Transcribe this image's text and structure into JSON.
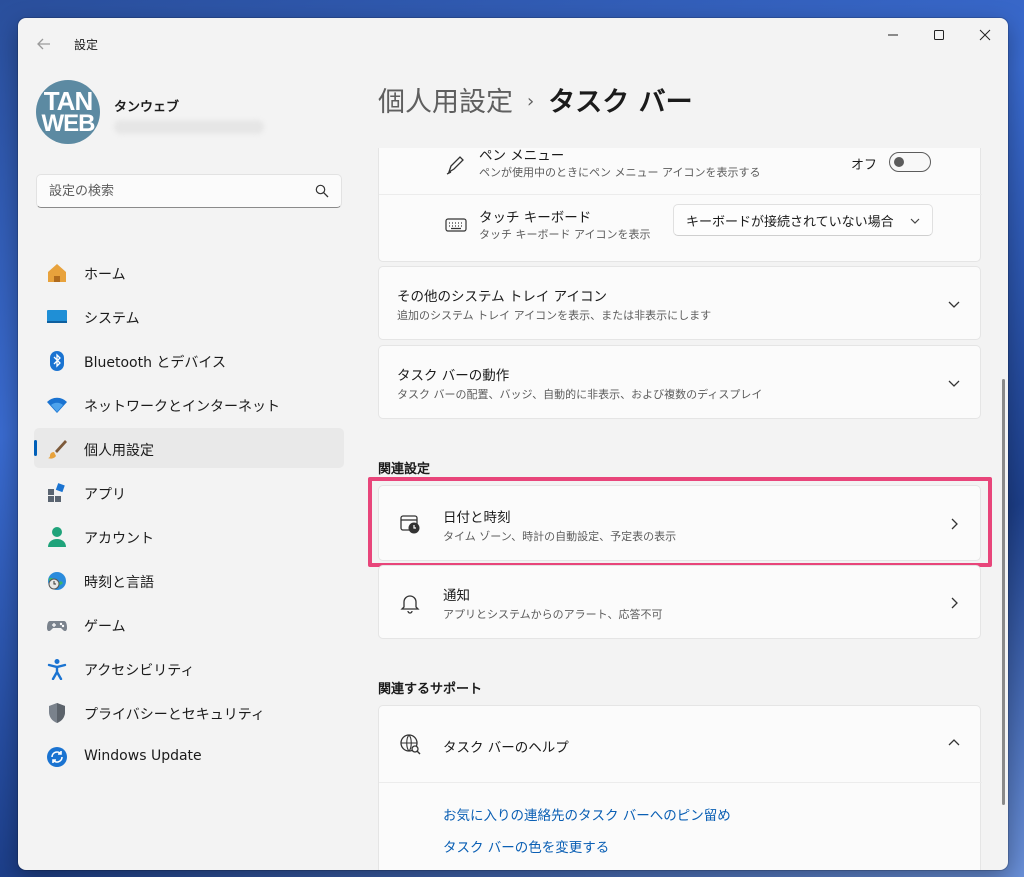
{
  "window": {
    "app_title": "設定"
  },
  "profile": {
    "name": "タンウェブ",
    "avatar_text_1": "TAN",
    "avatar_text_2": "WEB"
  },
  "search": {
    "placeholder": "設定の検索"
  },
  "sidebar": {
    "items": [
      {
        "label": "ホーム",
        "icon": "home-icon"
      },
      {
        "label": "システム",
        "icon": "display-icon"
      },
      {
        "label": "Bluetooth とデバイス",
        "icon": "bluetooth-icon"
      },
      {
        "label": "ネットワークとインターネット",
        "icon": "wifi-icon"
      },
      {
        "label": "個人用設定",
        "icon": "brush-icon",
        "active": true
      },
      {
        "label": "アプリ",
        "icon": "apps-icon"
      },
      {
        "label": "アカウント",
        "icon": "person-icon"
      },
      {
        "label": "時刻と言語",
        "icon": "globe-clock-icon"
      },
      {
        "label": "ゲーム",
        "icon": "gamepad-icon"
      },
      {
        "label": "アクセシビリティ",
        "icon": "accessibility-icon"
      },
      {
        "label": "プライバシーとセキュリティ",
        "icon": "shield-icon"
      },
      {
        "label": "Windows Update",
        "icon": "update-icon"
      }
    ]
  },
  "breadcrumb": {
    "parent": "個人用設定",
    "separator": "›",
    "current": "タスク バー"
  },
  "pen_menu": {
    "title": "ペン メニュー",
    "desc": "ペンが使用中のときにペン メニュー アイコンを表示する",
    "toggle_label": "オフ",
    "toggle_on": false
  },
  "touch_keyboard": {
    "title": "タッチ キーボード",
    "desc": "タッチ キーボード アイコンを表示",
    "dropdown_value": "キーボードが接続されていない場合"
  },
  "other_tray": {
    "title": "その他のシステム トレイ アイコン",
    "desc": "追加のシステム トレイ アイコンを表示、または非表示にします"
  },
  "taskbar_behavior": {
    "title": "タスク バーの動作",
    "desc": "タスク バーの配置、バッジ、自動的に非表示、および複数のディスプレイ"
  },
  "related_settings": {
    "heading": "関連設定",
    "items": [
      {
        "title": "日付と時刻",
        "desc": "タイム ゾーン、時計の自動設定、予定表の表示",
        "icon": "calendar-clock-icon"
      },
      {
        "title": "通知",
        "desc": "アプリとシステムからのアラート、応答不可",
        "icon": "bell-icon"
      }
    ]
  },
  "related_support": {
    "heading": "関連するサポート",
    "help_title": "タスク バーのヘルプ",
    "links": [
      "お気に入りの連絡先のタスク バーへのピン留め",
      "タスク バーの色を変更する"
    ]
  },
  "colors": {
    "accent": "#005fb8",
    "link": "#0a5fb4",
    "highlight": "#e8457a"
  }
}
